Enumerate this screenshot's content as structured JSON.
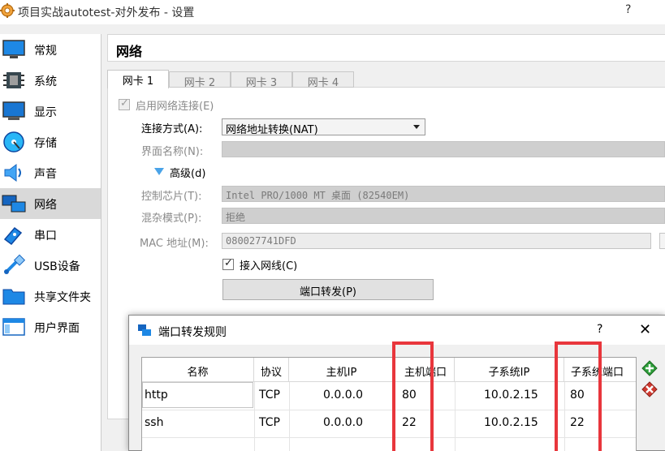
{
  "window": {
    "title": "项目实战autotest-对外发布 - 设置",
    "help": "?"
  },
  "sidebar": {
    "items": [
      {
        "label": "常规"
      },
      {
        "label": "系统"
      },
      {
        "label": "显示"
      },
      {
        "label": "存储"
      },
      {
        "label": "声音"
      },
      {
        "label": "网络",
        "active": true
      },
      {
        "label": "串口"
      },
      {
        "label": "USB设备"
      },
      {
        "label": "共享文件夹"
      },
      {
        "label": "用户界面"
      }
    ]
  },
  "panel": {
    "title": "网络",
    "tabs": [
      {
        "label": "网卡 1",
        "active": true
      },
      {
        "label": "网卡 2"
      },
      {
        "label": "网卡 3"
      },
      {
        "label": "网卡 4"
      }
    ]
  },
  "adapter": {
    "enable_label": "启用网络连接(E)",
    "enable_checked": true,
    "attach_label": "连接方式(A):",
    "attach_value": "网络地址转换(NAT)",
    "name_label": "界面名称(N):",
    "name_value": "",
    "advanced_label": "高级(d)",
    "chip_label": "控制芯片(T):",
    "chip_value": "Intel PRO/1000 MT 桌面 (82540EM)",
    "promisc_label": "混杂模式(P):",
    "promisc_value": "拒绝",
    "mac_label": "MAC 地址(M):",
    "mac_value": "080027741DFD",
    "cable_label": "接入网线(C)",
    "cable_checked": true,
    "port_forward_label": "端口转发(P)"
  },
  "dialog": {
    "title": "端口转发规则",
    "help": "?",
    "close": "✕",
    "columns": [
      "名称",
      "协议",
      "主机IP",
      "主机端口",
      "子系统IP",
      "子系统端口"
    ],
    "rows": [
      [
        "http",
        "TCP",
        "0.0.0.0",
        "80",
        "10.0.2.15",
        "80"
      ],
      [
        "ssh",
        "TCP",
        "0.0.0.0",
        "22",
        "10.0.2.15",
        "22"
      ]
    ]
  },
  "colors": {
    "highlight_box": "#e8363c",
    "active_sidebar": "#d9d9d9",
    "add_button": "#2e9e3a",
    "remove_button": "#d0392f"
  }
}
